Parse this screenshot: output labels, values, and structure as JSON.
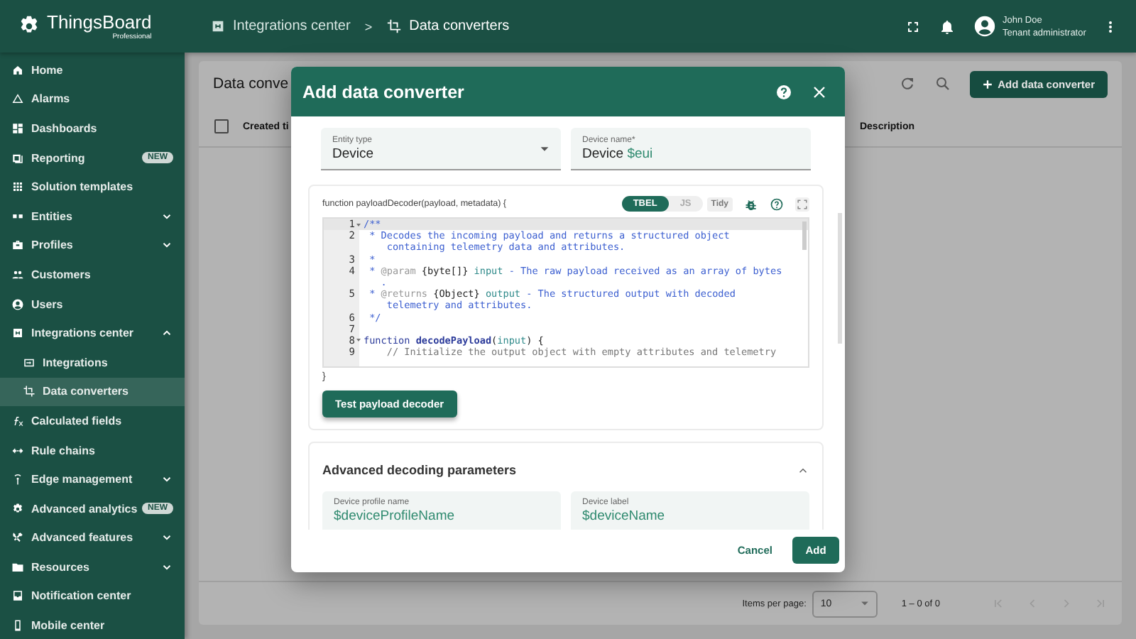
{
  "header": {
    "logo": {
      "name": "ThingsBoard",
      "edition": "Professional"
    },
    "breadcrumb_separator": ">",
    "breadcrumbs": [
      {
        "label": "Integrations center"
      },
      {
        "label": "Data converters"
      }
    ],
    "user": {
      "name": "John Doe",
      "role": "Tenant administrator"
    }
  },
  "sidebar": {
    "items": [
      {
        "label": "Home"
      },
      {
        "label": "Alarms"
      },
      {
        "label": "Dashboards"
      },
      {
        "label": "Reporting",
        "badge": "NEW"
      },
      {
        "label": "Solution templates"
      },
      {
        "label": "Entities",
        "expanded": false
      },
      {
        "label": "Profiles",
        "expanded": false
      },
      {
        "label": "Customers"
      },
      {
        "label": "Users"
      },
      {
        "label": "Integrations center",
        "expanded": true,
        "children": [
          {
            "label": "Integrations",
            "selected": false
          },
          {
            "label": "Data converters",
            "selected": true
          }
        ]
      },
      {
        "label": "Calculated fields"
      },
      {
        "label": "Rule chains"
      },
      {
        "label": "Edge management",
        "expanded": false
      },
      {
        "label": "Advanced analytics",
        "badge": "NEW"
      },
      {
        "label": "Advanced features",
        "expanded": false
      },
      {
        "label": "Resources",
        "expanded": false
      },
      {
        "label": "Notification center"
      },
      {
        "label": "Mobile center"
      }
    ]
  },
  "page": {
    "title": "Data conve",
    "add_button": "Add data converter",
    "table": {
      "select_all_checked": false,
      "columns": [
        "Created ti",
        "Description"
      ]
    },
    "pagination": {
      "items_per_page_label": "Items per page:",
      "page_size": "10",
      "range": "1 – 0 of 0"
    }
  },
  "dialog": {
    "title": "Add data converter",
    "entity_type": {
      "label": "Entity type",
      "value": "Device"
    },
    "device_name": {
      "label": "Device name*",
      "value": [
        {
          "text": "Device ",
          "kind": "plain"
        },
        {
          "text": "$eui",
          "kind": "variable"
        }
      ]
    },
    "decoder": {
      "signature": "function payloadDecoder(payload, metadata) {",
      "closing": "}",
      "languages": [
        {
          "label": "TBEL",
          "selected": true
        },
        {
          "label": "JS",
          "selected": false
        }
      ],
      "tidy": "Tidy",
      "lines": [
        {
          "number": "1",
          "fold": true,
          "active": true,
          "parts": [
            {
              "text": "/**",
              "kind": "comment"
            }
          ]
        },
        {
          "number": "2",
          "parts": [
            {
              "text": " * Decodes the incoming payload and returns a structured object",
              "kind": "comment"
            }
          ]
        },
        {
          "parts": [
            {
              "text": "    containing telemetry data and attributes.",
              "kind": "comment"
            }
          ]
        },
        {
          "number": "3",
          "parts": [
            {
              "text": " *",
              "kind": "comment"
            }
          ]
        },
        {
          "number": "4",
          "parts": [
            {
              "text": " * ",
              "kind": "comment"
            },
            {
              "text": "@param",
              "kind": "tag"
            },
            {
              "text": " {byte[]}",
              "kind": "type"
            },
            {
              "text": " input",
              "kind": "param"
            },
            {
              "text": " - The raw payload received as an array of bytes",
              "kind": "comment"
            }
          ]
        },
        {
          "parts": [
            {
              "text": "   .",
              "kind": "comment"
            }
          ]
        },
        {
          "number": "5",
          "parts": [
            {
              "text": " * ",
              "kind": "comment"
            },
            {
              "text": "@returns",
              "kind": "tag"
            },
            {
              "text": " {Object}",
              "kind": "type"
            },
            {
              "text": " output",
              "kind": "param"
            },
            {
              "text": " - The structured output with decoded",
              "kind": "comment"
            }
          ]
        },
        {
          "parts": [
            {
              "text": "    telemetry and attributes.",
              "kind": "comment"
            }
          ]
        },
        {
          "number": "6",
          "parts": [
            {
              "text": " */",
              "kind": "comment"
            }
          ]
        },
        {
          "number": "7"
        },
        {
          "number": "8",
          "fold": true,
          "parts": [
            {
              "text": "function",
              "kind": "keyword"
            },
            {
              "text": " decodePayload",
              "kind": "function"
            },
            {
              "text": "(",
              "kind": "plain"
            },
            {
              "text": "input",
              "kind": "param"
            },
            {
              "text": ") {",
              "kind": "plain"
            }
          ]
        },
        {
          "number": "9",
          "parts": [
            {
              "text": "    // Initialize the output object with empty attributes and telemetry",
              "kind": "line_comment"
            }
          ]
        }
      ],
      "test_button": "Test payload decoder"
    },
    "advanced": {
      "title": "Advanced decoding parameters",
      "expanded": true,
      "fields": [
        {
          "label": "Device profile name",
          "value": [
            {
              "text": "$deviceProfileName",
              "kind": "variable"
            }
          ]
        },
        {
          "label": "Device label",
          "value": [
            {
              "text": "$deviceName",
              "kind": "variable"
            }
          ]
        }
      ]
    },
    "buttons": {
      "cancel": "Cancel",
      "add": "Add"
    }
  }
}
